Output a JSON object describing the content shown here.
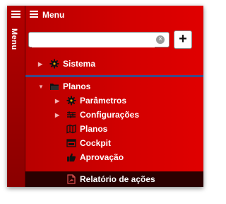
{
  "vertical_label": "Menu",
  "header": {
    "title": "Menu"
  },
  "search": {
    "value": "",
    "placeholder": ""
  },
  "tree": {
    "sistema": "Sistema",
    "planos": "Planos",
    "parametros": "Parâmetros",
    "configuracoes": "Configurações",
    "planos_child": "Planos",
    "cockpit": "Cockpit",
    "aprovacao": "Aprovação",
    "relatorio": "Relatório de ações"
  },
  "colors": {
    "accent": "#d40000",
    "divider": "#3b4a8a",
    "selected": "#2a0000"
  },
  "icons": [
    "hamburger-icon",
    "clear-icon",
    "plus-icon",
    "gear-icon",
    "folder-icon",
    "sliders-icon",
    "map-icon",
    "browser-icon",
    "thumbs-up-icon",
    "pdf-icon",
    "triangle-right-icon",
    "triangle-down-icon"
  ]
}
